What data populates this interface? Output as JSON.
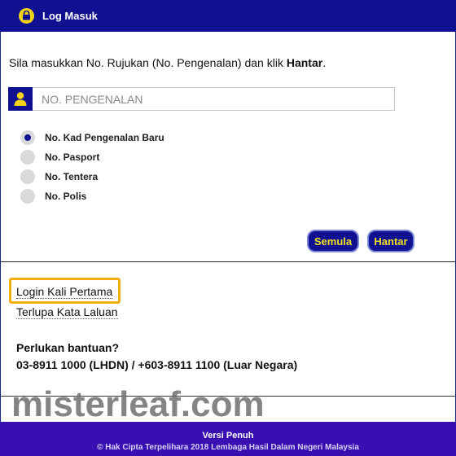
{
  "header": {
    "title": "Log Masuk",
    "icon": "lock-icon",
    "bg_color": "#0f1191"
  },
  "instruction": {
    "text": "Sila masukkan No. Rujukan (No. Pengenalan) dan klik ",
    "bold": "Hantar",
    "end": "."
  },
  "id_input": {
    "placeholder": "NO. PENGENALAN",
    "value": "",
    "icon": "user-icon"
  },
  "id_types": [
    {
      "label": "No. Kad Pengenalan Baru",
      "selected": true
    },
    {
      "label": "No. Pasport",
      "selected": false
    },
    {
      "label": "No. Tentera",
      "selected": false
    },
    {
      "label": "No. Polis",
      "selected": false
    }
  ],
  "buttons": {
    "reset_label": "Semula",
    "submit_label": "Hantar",
    "text_color": "#f3e020"
  },
  "links": {
    "first_login": "Login Kali Pertama",
    "forgot_password": "Terlupa Kata Laluan",
    "highlight_color": "#f4ad12"
  },
  "help": {
    "title": "Perlukan bantuan?",
    "phone": "03-8911 1000 (LHDN) / +603-8911 1100 (Luar Negara)"
  },
  "watermark": "misterleaf.com",
  "footer": {
    "full_version": "Versi Penuh",
    "copyright": "© Hak Cipta Terpelihara 2018 Lembaga Hasil Dalam Negeri Malaysia",
    "bg_color": "#3a0fb1"
  }
}
